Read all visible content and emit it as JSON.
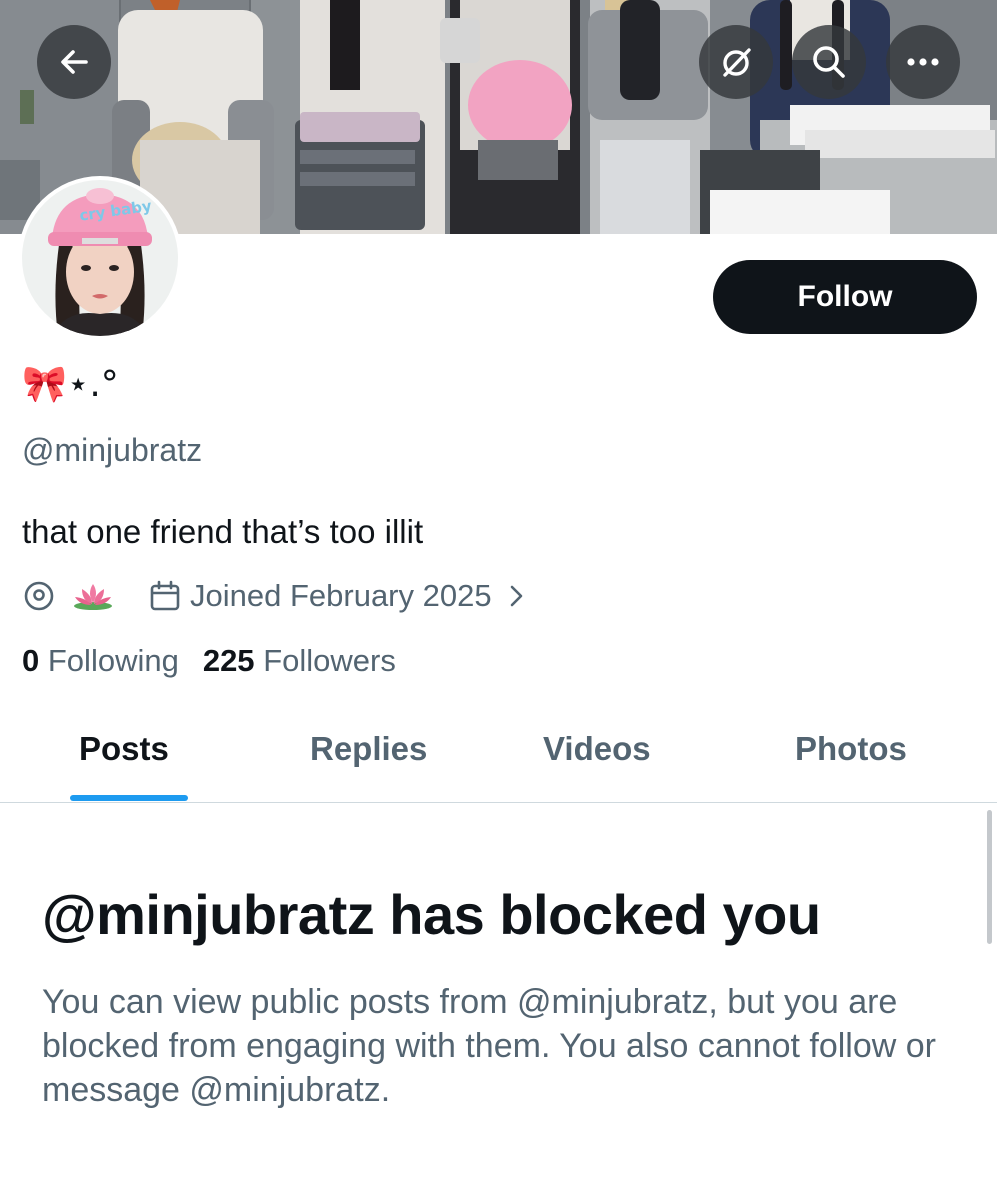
{
  "header": {
    "back_icon": "arrow-left-icon",
    "grok_icon": "slashed-circle-icon",
    "search_icon": "search-icon",
    "more_icon": "more-horizontal-icon"
  },
  "banner": {
    "cap_text": "cry baby"
  },
  "profile": {
    "display_name": "🎀⋆.°",
    "handle": "@minjubratz",
    "bio": "that one friend that’s too illit",
    "location_icon": "location-pin-icon",
    "location_value_icon": "lotus-icon",
    "joined": "Joined February 2025",
    "following_count": "0",
    "following_label": "Following",
    "followers_count": "225",
    "followers_label": "Followers",
    "follow_button": "Follow"
  },
  "tabs": [
    {
      "label": "Posts",
      "active": true
    },
    {
      "label": "Replies",
      "active": false
    },
    {
      "label": "Videos",
      "active": false
    },
    {
      "label": "Photos",
      "active": false
    }
  ],
  "blocked": {
    "title": "@minjubratz has blocked you",
    "description": "You can view public posts from @minjubratz, but you are blocked from engaging with them. You also cannot follow or message @minjubratz."
  },
  "colors": {
    "primary_text": "#0f1419",
    "secondary_text": "#536471",
    "accent": "#1d9bf0",
    "follow_button_bg": "#0f1419",
    "divider": "#cfd9de"
  }
}
